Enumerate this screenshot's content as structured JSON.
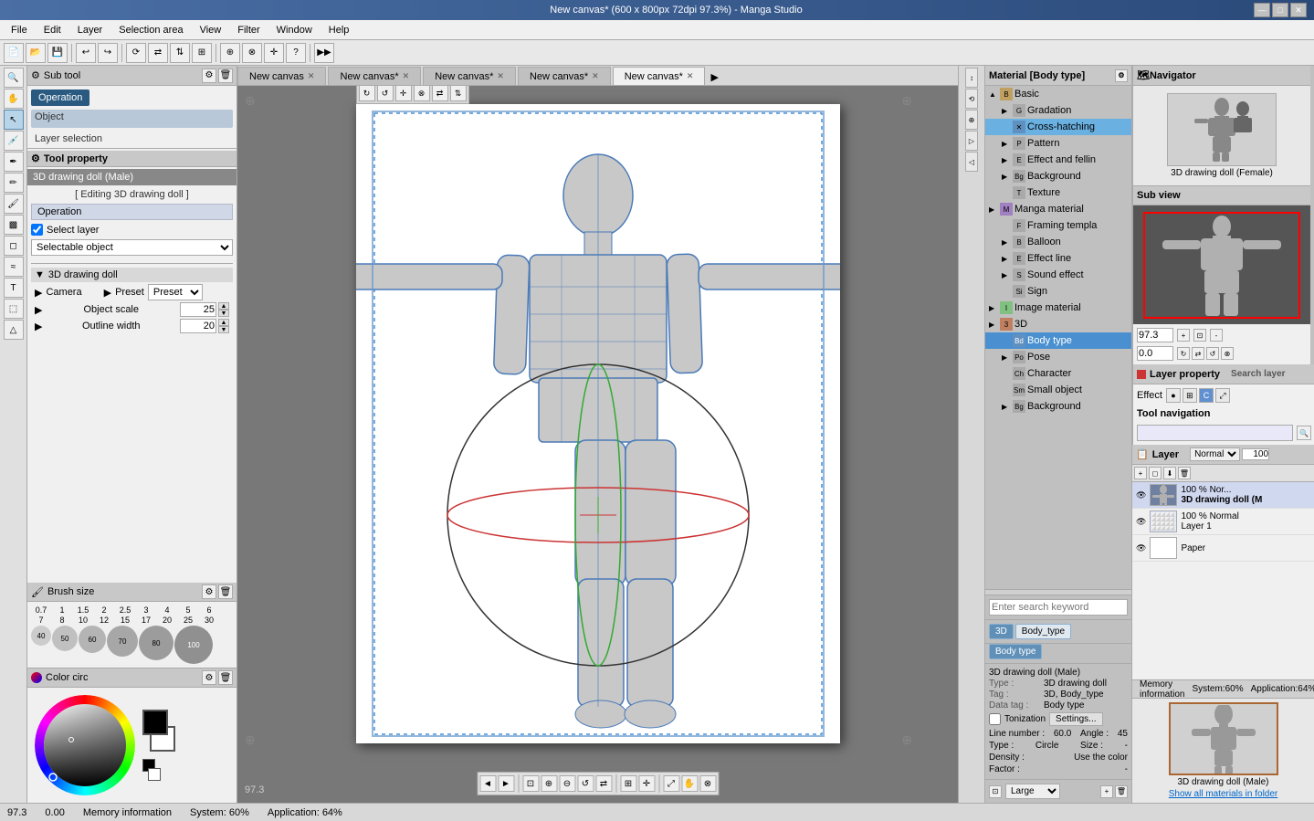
{
  "titlebar": {
    "title": "New canvas* (600 x 800px 72dpi 97.3%)  - Manga Studio",
    "minimize": "—",
    "maximize": "□",
    "close": "✕"
  },
  "menubar": {
    "items": [
      "File",
      "Edit",
      "Layer",
      "Selection area",
      "View",
      "Filter",
      "Window",
      "Help"
    ]
  },
  "tabs": [
    {
      "label": "New canvas",
      "active": false
    },
    {
      "label": "New canvas*",
      "active": false
    },
    {
      "label": "New canvas*",
      "active": false
    },
    {
      "label": "New canvas*",
      "active": false
    },
    {
      "label": "New canvas*",
      "active": true
    }
  ],
  "subtool": {
    "header": "Sub tool",
    "operation_label": "Operation",
    "object_label": "Object",
    "layer_selection_label": "Layer selection"
  },
  "tool_property": {
    "header": "Tool property",
    "doll_name": "3D drawing doll (Male)",
    "editing_label": "[ Editing 3D drawing doll ]",
    "operation_label": "Operation",
    "select_layer_label": "Select layer",
    "selectable_object": "Selectable object",
    "drawing_doll_label": "3D drawing doll",
    "camera_label": "Camera",
    "preset_label": "Preset",
    "object_scale_label": "Object scale",
    "object_scale_value": "25",
    "outline_width_label": "Outline width",
    "outline_width_value": "20"
  },
  "brush_sizes": [
    "0.7",
    "1",
    "1.5",
    "2",
    "2.5",
    "3",
    "4",
    "5",
    "6",
    "7",
    "8",
    "10",
    "12",
    "15",
    "17",
    "20",
    "25",
    "30",
    "40",
    "50",
    "60",
    "70",
    "80",
    "100"
  ],
  "material_panel": {
    "header": "Material [Body type]",
    "tree_items": [
      {
        "label": "Basic",
        "indent": 0,
        "arrow": "▲",
        "expanded": true
      },
      {
        "label": "Gradation",
        "indent": 1,
        "arrow": "▶"
      },
      {
        "label": "Cross-hatching",
        "indent": 1,
        "arrow": "",
        "selected": true
      },
      {
        "label": "Pattern",
        "indent": 1,
        "arrow": "▶"
      },
      {
        "label": "Effect and felling",
        "indent": 1,
        "arrow": "▶"
      },
      {
        "label": "Background",
        "indent": 1,
        "arrow": "▶"
      },
      {
        "label": "Texture",
        "indent": 1,
        "arrow": ""
      },
      {
        "label": "Manga material",
        "indent": 0,
        "arrow": "▶",
        "expanded": true
      },
      {
        "label": "Framing template",
        "indent": 1,
        "arrow": ""
      },
      {
        "label": "Balloon",
        "indent": 1,
        "arrow": "▶"
      },
      {
        "label": "Effect line",
        "indent": 1,
        "arrow": "▶"
      },
      {
        "label": "Sound effect",
        "indent": 1,
        "arrow": "▶"
      },
      {
        "label": "Sign",
        "indent": 1,
        "arrow": ""
      },
      {
        "label": "Image material",
        "indent": 0,
        "arrow": "▶"
      },
      {
        "label": "3D",
        "indent": 0,
        "arrow": "▶",
        "expanded": true
      },
      {
        "label": "Body type",
        "indent": 1,
        "arrow": "",
        "selected": true,
        "highlighted": true
      },
      {
        "label": "Pose",
        "indent": 1,
        "arrow": "▶"
      },
      {
        "label": "Character",
        "indent": 1,
        "arrow": ""
      },
      {
        "label": "Small object",
        "indent": 1,
        "arrow": ""
      },
      {
        "label": "Background",
        "indent": 1,
        "arrow": "▶"
      }
    ],
    "search_placeholder": "Enter search keyword",
    "tags": [
      "3D",
      "Body_type"
    ],
    "active_tag": "Body type",
    "size_options": [
      "Large"
    ],
    "selected_size": "Large"
  },
  "preview_panel": {
    "header": "Navigator",
    "female_label": "3D drawing doll (Female)",
    "male_label": "3D drawing doll (Male)",
    "show_all_label": "Show all materials in folder",
    "zoom_value": "97.3",
    "position_value": "0.0"
  },
  "layer_property": {
    "header": "Layer property",
    "tab2": "Search layer",
    "effect_label": "Effect",
    "tool_nav_label": "Tool navigation"
  },
  "layer_panel": {
    "header": "Layer",
    "blend_mode": "Normal",
    "opacity": "100",
    "layers": [
      {
        "name": "3D drawing doll (M",
        "blend": "Nor...",
        "opacity": "100 %",
        "thumb_color": "#8090a0"
      },
      {
        "name": "Layer 1",
        "blend": "Normal",
        "opacity": "100 %",
        "thumb_color": "#e8e8e8"
      },
      {
        "name": "Paper",
        "blend": "",
        "opacity": "",
        "thumb_color": "#ffffff"
      }
    ]
  },
  "info_panel": {
    "name": "3D drawing doll (Male)",
    "type_label": "Type :",
    "type_value": "3D drawing doll",
    "tag_label": "Tag :",
    "tag_value": "3D, Body_type",
    "data_tag_label": "Data tag :",
    "data_tag_value": "Body type",
    "tonize_label": "Tonization",
    "settings_label": "Settings...",
    "line_number_label": "Line number :",
    "line_number_value": "60.0",
    "angle_label": "Angle :",
    "angle_value": "45",
    "type2_label": "Type :",
    "type2_value": "Circle",
    "size_label": "Size :",
    "size_value": "-",
    "density_label": "Density :",
    "density_value": "Use the color",
    "factor_label": "Factor :",
    "factor_value": "-"
  },
  "statusbar": {
    "zoom": "97.3",
    "position": "0.00",
    "memory_label": "Memory information",
    "system_label": "System:",
    "system_value": "60%",
    "app_label": "Application:",
    "app_value": "64%"
  },
  "sub_view_header": "Sub view",
  "canvas_tools": {
    "prev": "◄",
    "next": "►"
  }
}
